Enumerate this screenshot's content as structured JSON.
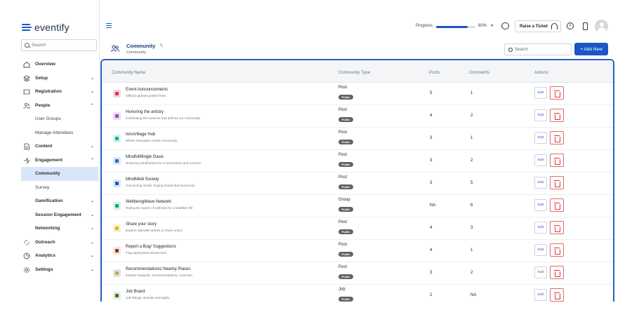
{
  "app": {
    "logo_text": "eventify",
    "search_placeholder": "Search"
  },
  "sidebar": {
    "items": [
      {
        "label": "Overview",
        "icon": "home-icon",
        "type": "top",
        "chevron": ""
      },
      {
        "label": "Setup",
        "icon": "layers-icon",
        "type": "top",
        "chevron": "⌄"
      },
      {
        "label": "Registration",
        "icon": "ticket-icon",
        "type": "top",
        "chevron": "⌄"
      },
      {
        "label": "People",
        "icon": "people-icon",
        "type": "top",
        "chevron": "⌃"
      },
      {
        "label": "User Groups",
        "icon": "",
        "type": "sub",
        "chevron": ""
      },
      {
        "label": "Manage Attendees",
        "icon": "",
        "type": "sub",
        "chevron": ""
      },
      {
        "label": "Content",
        "icon": "document-icon",
        "type": "top",
        "chevron": "⌄"
      },
      {
        "label": "Engagement",
        "icon": "engagement-icon",
        "type": "top",
        "chevron": "⌃"
      },
      {
        "label": "Community",
        "icon": "",
        "type": "sub-active",
        "chevron": ""
      },
      {
        "label": "Survey",
        "icon": "",
        "type": "sub",
        "chevron": ""
      },
      {
        "label": "Gamification",
        "icon": "",
        "type": "sub-bold",
        "chevron": "⌄"
      },
      {
        "label": "Session Engagement",
        "icon": "",
        "type": "sub-bold",
        "chevron": "⌄"
      },
      {
        "label": "Networking",
        "icon": "",
        "type": "sub-bold",
        "chevron": "⌄"
      },
      {
        "label": "Outreach",
        "icon": "outreach-icon",
        "type": "top",
        "chevron": "⌄"
      },
      {
        "label": "Analytics",
        "icon": "analytics-icon",
        "type": "top",
        "chevron": "⌄"
      },
      {
        "label": "Settings",
        "icon": "settings-icon",
        "type": "top",
        "chevron": "⌄"
      }
    ]
  },
  "topbar": {
    "progress_label": "Progress",
    "progress_value": "80%",
    "progress_fraction": 0.8,
    "ticket_label": "Raise a Ticket",
    "info_symbol": "i"
  },
  "subheader": {
    "title": "Community",
    "breadcrumb": "Community",
    "search_placeholder": "Search",
    "add_label": "+ Add New"
  },
  "table": {
    "headers": {
      "name": "Community Name",
      "type": "Community Type",
      "posts": "Posts",
      "comments": "Comments",
      "actions": "Actions"
    },
    "edit_label": "Edit",
    "rows": [
      {
        "name": "Event Announcements",
        "desc": "Official updates posted here.",
        "type": "Post",
        "badge": "Public",
        "posts": "5",
        "comments": "1",
        "color": "#f6d6dc",
        "inner": "#d8364f"
      },
      {
        "name": "Honoring the artistry",
        "desc": "Celebrating the essence that defines our community",
        "type": "Post",
        "badge": "Public",
        "posts": "4",
        "comments": "2",
        "color": "#eadcf3",
        "inner": "#8e4fbf"
      },
      {
        "name": "InnoVillage Hub",
        "desc": "Where innovation meets community.",
        "type": "Post",
        "badge": "Public",
        "posts": "3",
        "comments": "1",
        "color": "#d6f2ef",
        "inner": "#23a99b"
      },
      {
        "name": "MindfulMingle Oasis",
        "desc": "Nurturing mindfulness for a harmonious and connect",
        "type": "Post",
        "badge": "Public",
        "posts": "3",
        "comments": "2",
        "color": "#d8e6f7",
        "inner": "#2b6cc1"
      },
      {
        "name": "MindMeld Society",
        "desc": "Connecting minds, forging bonds that transcend",
        "type": "Post",
        "badge": "Public",
        "posts": "3",
        "comments": "5",
        "color": "#d8e6f7",
        "inner": "#1a56c4"
      },
      {
        "name": "WellbeingWave Network",
        "desc": "Riding the waves of wellness for a healthier life",
        "type": "Group",
        "badge": "Public",
        "posts": "NA",
        "comments": "6",
        "color": "#d4f0ea",
        "inner": "#1aa38a"
      },
      {
        "name": "Share your story",
        "desc": "Explore attendee stories or share yours.",
        "type": "Post",
        "badge": "Public",
        "posts": "4",
        "comments": "3",
        "color": "#fdf1cc",
        "inner": "#e0b321"
      },
      {
        "name": "Report a Bug/ Suggestions",
        "desc": "Flag app/system issues here.",
        "type": "Post",
        "badge": "Public",
        "posts": "4",
        "comments": "1",
        "color": "#fde2d6",
        "inner": "#6b4a2e"
      },
      {
        "name": "Recommendations/ Nearby Places",
        "desc": "Explore hotspots, recommendations, must-see.",
        "type": "Post",
        "badge": "Public",
        "posts": "3",
        "comments": "2",
        "color": "#dbe4f5",
        "inner": "#e0a81e"
      },
      {
        "name": "Job Board",
        "desc": "Job listings. Browse and apply.",
        "type": "Job",
        "badge": "Public",
        "posts": "2",
        "comments": "NA",
        "color": "#e2efdc",
        "inner": "#4d6b3a"
      }
    ]
  },
  "colors": {
    "accent": "#1a56c4",
    "active_bg": "#d8e6f9",
    "danger": "#d23b3b"
  }
}
